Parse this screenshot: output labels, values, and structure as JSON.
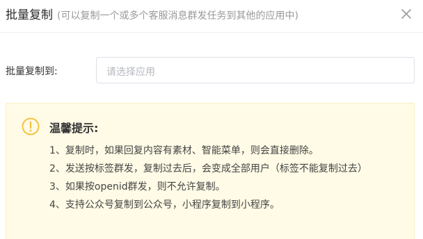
{
  "dialog": {
    "title": "批量复制",
    "subtitle": "(可以复制一个或多个客服消息群发任务到其他的应用中)",
    "close_icon": "close-icon"
  },
  "form": {
    "label": "批量复制到:",
    "select_placeholder": "请选择应用"
  },
  "warning": {
    "icon": "warning-icon",
    "accent_color": "#f5c242",
    "background_color": "#fffbe6",
    "title": "温馨提示:",
    "tips": [
      "1、复制时，如果回复内容有素材、智能菜单，则会直接删除。",
      "2、发送按标签群发，复制过去后，会变成全部用户（标签不能复制过去）",
      "3、如果按openid群发，则不允许复制。",
      "4、支持公众号复制到公众号，小程序复制到小程序。"
    ]
  }
}
